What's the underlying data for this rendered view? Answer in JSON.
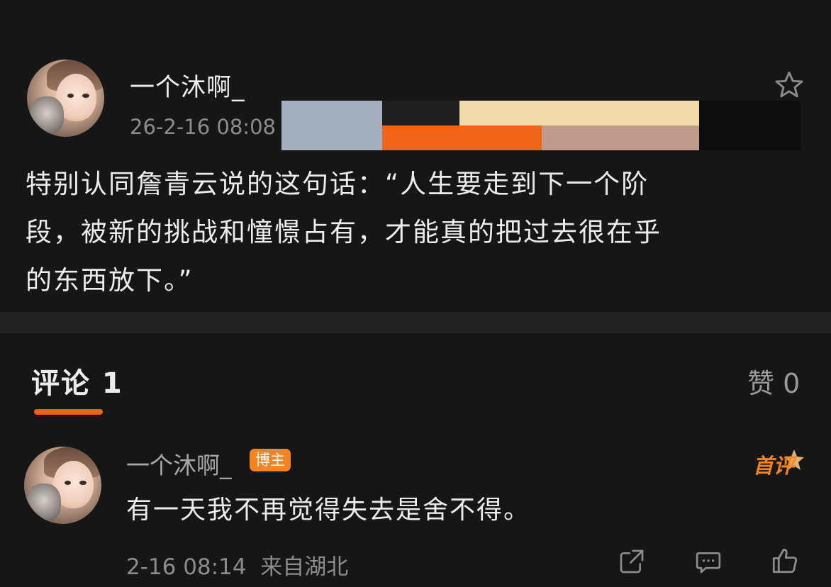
{
  "post": {
    "author": "一个沐啊_",
    "timestamp": "26-2-16 08:08",
    "text_lines": [
      "特别认同詹青云说的这句话：“人生要走到下一个阶",
      "段，被新的挑战和憧憬占有，才能真的把过去很在乎",
      "的东西放下。”"
    ]
  },
  "comments_section": {
    "tab_label": "评论 1",
    "likes_label": "赞 0"
  },
  "comments": [
    {
      "author": "一个沐啊_",
      "badge": "博主",
      "first_badge": "首评",
      "text": "有一天我不再觉得失去是舍不得。",
      "meta": "2-16 08:14  来自湖北"
    }
  ],
  "icons": {
    "favorite": "star-icon",
    "share": "share-icon",
    "comment": "comment-icon",
    "like": "thumbs-up-icon"
  },
  "colors": {
    "background": "#161616",
    "accent": "#e2641e",
    "badge": "#f28423"
  },
  "redaction_colors": [
    "#a3aebf",
    "#1f1f1f",
    "#f2d9a9",
    "#ef6519",
    "#c09a8c",
    "#0d0d0d"
  ]
}
